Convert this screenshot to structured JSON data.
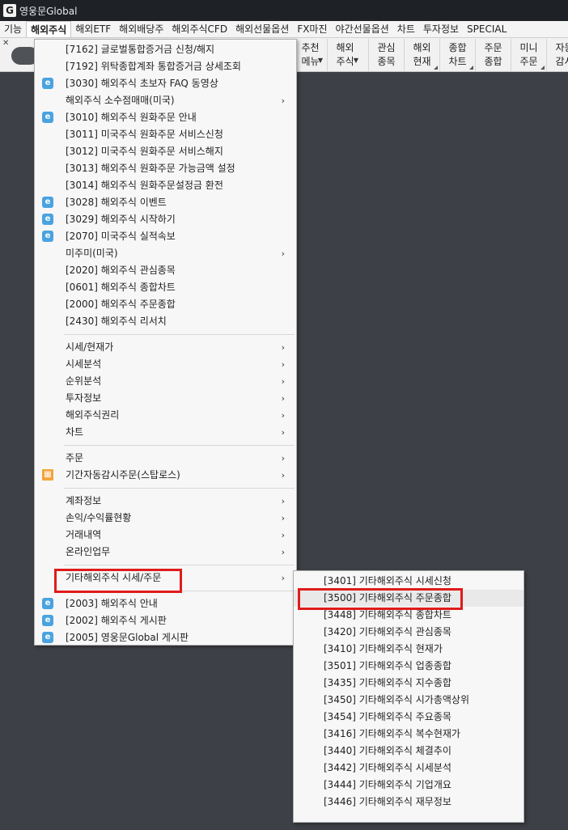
{
  "app": {
    "title": "영웅문Global",
    "logo": "G"
  },
  "menubar": [
    "기능",
    "해외주식",
    "해외ETF",
    "해외배당주",
    "해외주식CFD",
    "해외선물옵션",
    "FX마진",
    "야간선물옵션",
    "차트",
    "투자정보",
    "SPECIAL"
  ],
  "toolbar": {
    "partial_label_1": "추천",
    "partial_label_2": "메뉴",
    "buttons": [
      {
        "l1": "해외",
        "l2": "주식"
      },
      {
        "l1": "관심",
        "l2": "종목"
      },
      {
        "l1": "해외",
        "l2": "현재"
      },
      {
        "l1": "종합",
        "l2": "차트"
      },
      {
        "l1": "주문",
        "l2": "종합"
      },
      {
        "l1": "미니",
        "l2": "주문"
      },
      {
        "l1": "자동",
        "l2": "감시"
      }
    ]
  },
  "main_menu": {
    "items": [
      {
        "label": "[7162] 글로벌통합증거금 신청/해지"
      },
      {
        "label": "[7192] 위탁종합계좌 통합증거금 상세조회"
      },
      {
        "label": "[3030] 해외주식 초보자 FAQ 동영상",
        "icon": "web-link-icon"
      },
      {
        "label": "해외주식 소수점매매(미국)",
        "submenu": true
      },
      {
        "label": "[3010] 해외주식 원화주문 안내",
        "icon": "web-link-icon"
      },
      {
        "label": "[3011] 미국주식 원화주문 서비스신청"
      },
      {
        "label": "[3012] 미국주식 원화주문 서비스해지"
      },
      {
        "label": "[3013] 해외주식 원화주문 가능금액 설정"
      },
      {
        "label": "[3014] 해외주식 원화주문설정금 환전"
      },
      {
        "label": "[3028] 해외주식 이벤트",
        "icon": "web-link-icon"
      },
      {
        "label": "[3029] 해외주식 시작하기",
        "icon": "web-link-icon"
      },
      {
        "label": "[2070] 미국주식 실적속보",
        "icon": "web-link-icon"
      },
      {
        "label": "미주미(미국)",
        "submenu": true
      },
      {
        "label": "[2020] 해외주식 관심종목"
      },
      {
        "label": "[0601] 해외주식 종합차트"
      },
      {
        "label": "[2000] 해외주식 주문종합"
      },
      {
        "label": "[2430] 해외주식 리서치"
      }
    ],
    "group2": [
      {
        "label": "시세/현재가",
        "submenu": true
      },
      {
        "label": "시세분석",
        "submenu": true
      },
      {
        "label": "순위분석",
        "submenu": true
      },
      {
        "label": "투자정보",
        "submenu": true
      },
      {
        "label": "해외주식권리",
        "submenu": true
      },
      {
        "label": "차트",
        "submenu": true
      }
    ],
    "group3": [
      {
        "label": "주문",
        "submenu": true
      },
      {
        "label": "기간자동감시주문(스탑로스)",
        "submenu": true,
        "icon": "calendar-icon"
      }
    ],
    "group4": [
      {
        "label": "계좌정보",
        "submenu": true
      },
      {
        "label": "손익/수익률현황",
        "submenu": true
      },
      {
        "label": "거래내역",
        "submenu": true
      },
      {
        "label": "온라인업무",
        "submenu": true
      }
    ],
    "group5": [
      {
        "label": "기타해외주식 시세/주문",
        "submenu": true
      }
    ],
    "group6": [
      {
        "label": "[2003] 해외주식 안내",
        "icon": "web-link-icon"
      },
      {
        "label": "[2002] 해외주식 게시판",
        "icon": "web-link-icon"
      },
      {
        "label": "[2005] 영웅문Global 게시판",
        "icon": "web-link-icon"
      }
    ]
  },
  "sub_menu": {
    "items": [
      {
        "label": "[3401] 기타해외주식 시세신청"
      },
      {
        "label": "[3500] 기타해외주식 주문종합",
        "highlighted": true
      },
      {
        "label": "[3448] 기타해외주식 종합차트"
      },
      {
        "label": "[3420] 기타해외주식 관심종목"
      },
      {
        "label": "[3410] 기타해외주식 현재가"
      },
      {
        "label": "[3501] 기타해외주식 업종종합"
      },
      {
        "label": "[3435] 기타해외주식 지수종합"
      },
      {
        "label": "[3450] 기타해외주식 시가총액상위"
      },
      {
        "label": "[3454] 기타해외주식 주요종목"
      },
      {
        "label": "[3416] 기타해외주식 복수현재가"
      },
      {
        "label": "[3440] 기타해외주식 체결추이"
      },
      {
        "label": "[3442] 기타해외주식 시세분석"
      },
      {
        "label": "[3444] 기타해외주식 기업개요"
      },
      {
        "label": "[3446] 기타해외주식 재무정보"
      }
    ]
  },
  "colors": {
    "highlight_box": "#e01b1b",
    "workspace": "#3d4046",
    "titlebar": "#1e2126"
  }
}
